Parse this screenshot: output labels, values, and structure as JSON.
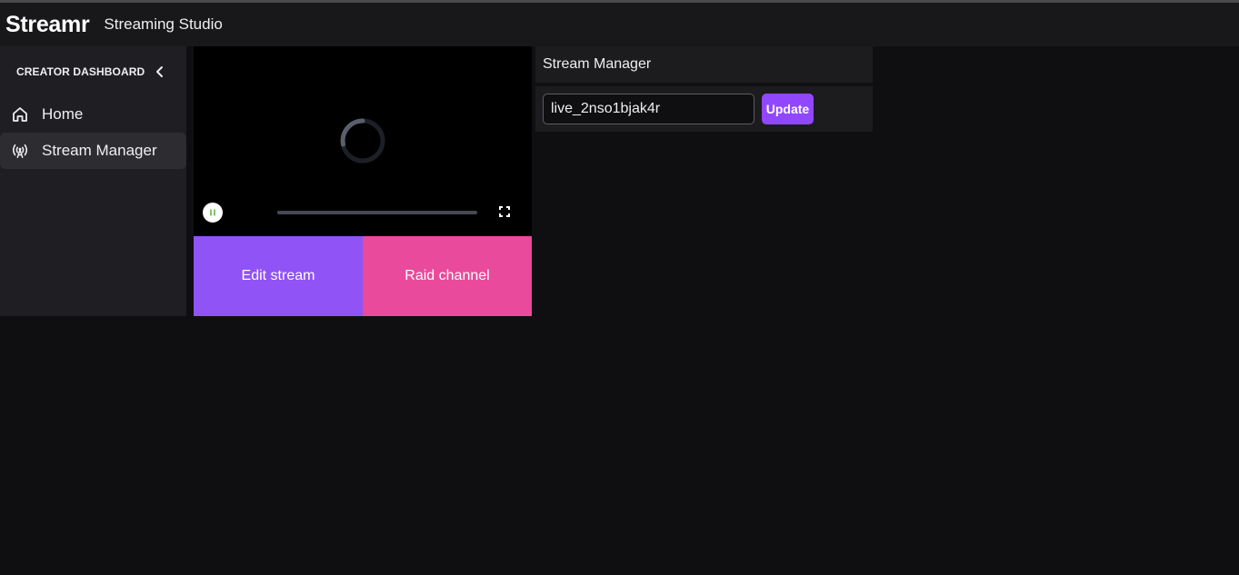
{
  "header": {
    "logo": "Streamr",
    "app_title": "Streaming Studio"
  },
  "sidebar": {
    "heading": "CREATOR DASHBOARD",
    "collapse_icon": "chevron-left-icon",
    "items": [
      {
        "label": "Home",
        "icon": "home-icon",
        "active": false
      },
      {
        "label": "Stream Manager",
        "icon": "broadcast-icon",
        "active": true
      }
    ]
  },
  "player": {
    "state": "loading",
    "progress": 0,
    "play_icon": "pause-icon",
    "fullscreen_icon": "fullscreen-icon"
  },
  "actions": {
    "edit_label": "Edit stream",
    "raid_label": "Raid channel"
  },
  "manager": {
    "title": "Stream Manager",
    "stream_key_value": "live_2nso1bjak4r",
    "update_label": "Update"
  },
  "colors": {
    "edit_button": "#9053f5",
    "raid_button": "#ea4a9b",
    "update_button": "#9147ff",
    "background": "#0f0f11",
    "sidebar": "#1f1f23"
  }
}
